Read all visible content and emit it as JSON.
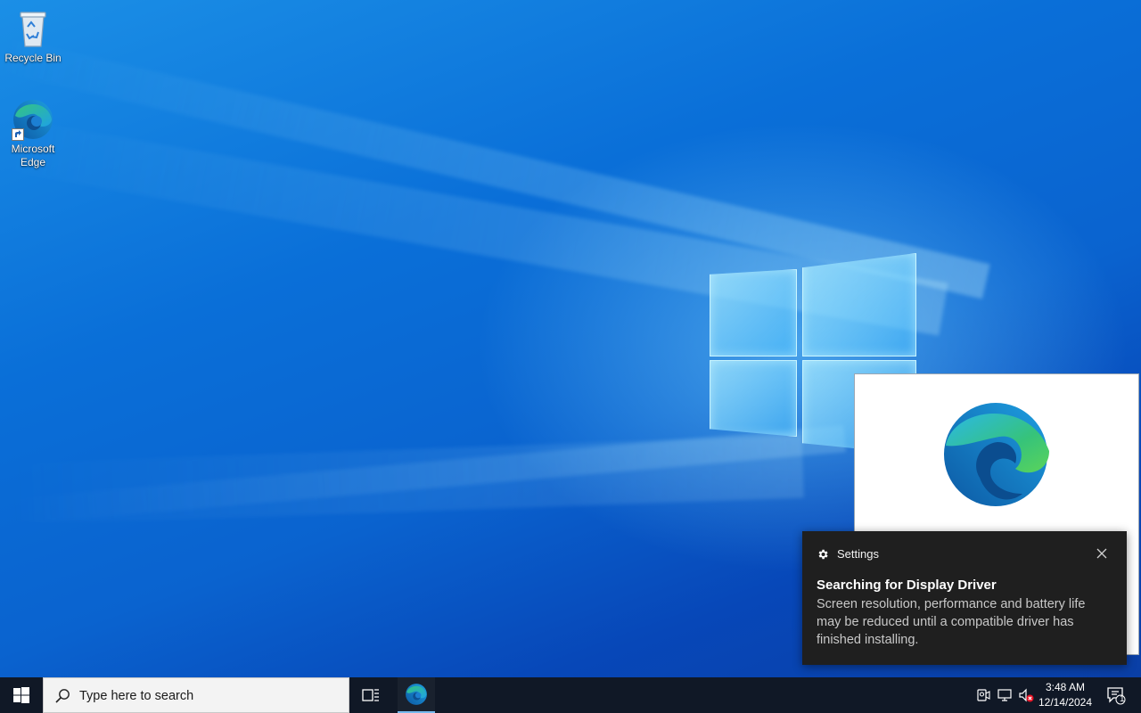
{
  "desktop": {
    "icons": [
      {
        "label": "Recycle Bin",
        "icon": "recycle-bin-icon"
      },
      {
        "label": "Microsoft Edge",
        "icon": "edge-icon"
      }
    ]
  },
  "notification": {
    "app_name": "Settings",
    "app_icon": "gear-icon",
    "title": "Searching for Display Driver",
    "body": "Screen resolution, performance and battery life may be reduced until a compatible driver has finished installing."
  },
  "taskbar": {
    "search_placeholder": "Type here to search",
    "pinned": [
      "task-view-icon",
      "edge-icon"
    ],
    "tray_icons": [
      "meet-now-icon",
      "network-icon",
      "volume-muted-icon"
    ],
    "time": "3:48 AM",
    "date": "12/14/2024",
    "notification_count": "1"
  },
  "colors": {
    "taskbar": "#101826",
    "toast_bg": "#1f1f1f",
    "accent": "#0a6fd8"
  }
}
